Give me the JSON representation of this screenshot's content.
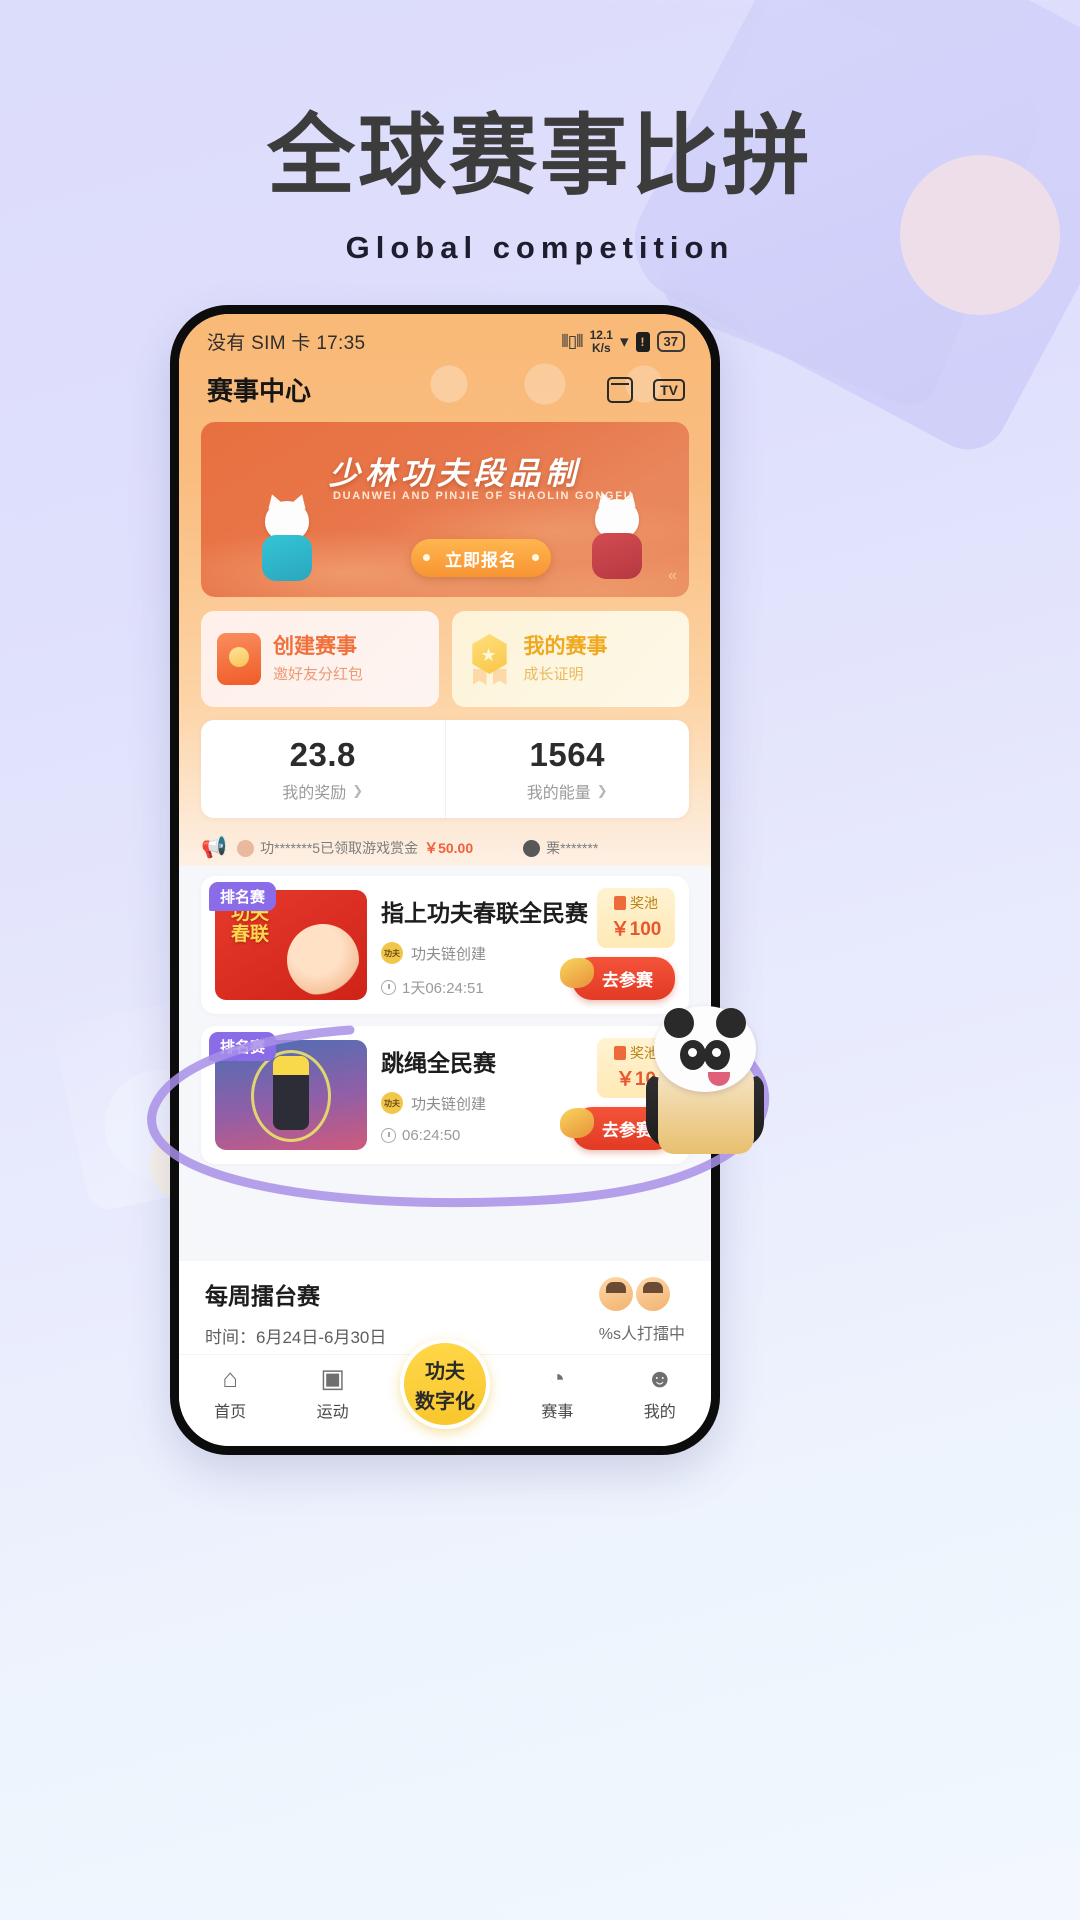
{
  "page": {
    "headline": "全球赛事比拼",
    "subheadline": "Global competition"
  },
  "statusbar": {
    "carrier_time": "没有 SIM 卡 17:35",
    "vibrate_icon": "vibrate-icon",
    "net_speed_value": "12.1",
    "net_speed_unit": "K/s",
    "wifi_icon": "wifi-icon",
    "battery_alert_icon": "!",
    "battery_level": "37"
  },
  "appheader": {
    "title": "赛事中心",
    "calendar_icon": "calendar-icon",
    "tv_icon": "TV"
  },
  "banner": {
    "title": "少林功夫段品制",
    "subtitle": "DUANWEI AND PINJIE OF SHAOLIN GONGFU",
    "cta": "立即报名",
    "arrows": "«"
  },
  "quick_cards": [
    {
      "title": "创建赛事",
      "subtitle": "邀好友分红包",
      "icon": "red-envelope-icon"
    },
    {
      "title": "我的赛事",
      "subtitle": "成长证明",
      "icon": "medal-icon"
    }
  ],
  "stats": [
    {
      "value": "23.8",
      "label": "我的奖励",
      "chevron": "❯"
    },
    {
      "value": "1564",
      "label": "我的能量",
      "chevron": "❯"
    }
  ],
  "notice": {
    "horn_icon": "📢",
    "items": [
      {
        "text": "功*******5已领取游戏赏金",
        "amount": "￥50.00"
      },
      {
        "text": "栗*******",
        "amount": ""
      }
    ]
  },
  "matches": [
    {
      "badge": "排名赛",
      "title": "指上功夫春联全民赛",
      "creator": "功夫链创建",
      "countdown": "1天06:24:51",
      "pool_label": "奖池",
      "pool_value": "￥100",
      "join": "去参赛",
      "thumb": "spring-festival-couplet-thumb"
    },
    {
      "badge": "排名赛",
      "title": "跳绳全民赛",
      "creator": "功夫链创建",
      "countdown": "06:24:50",
      "pool_label": "奖池",
      "pool_value": "￥10",
      "join": "去参赛",
      "thumb": "jump-rope-thumb"
    }
  ],
  "weekly": {
    "title": "每周擂台赛",
    "time": "时间：6月24日-6月30日",
    "participants": "%s人打擂中"
  },
  "tabbar": {
    "items": [
      {
        "label": "首页",
        "icon": "home-icon"
      },
      {
        "label": "运动",
        "icon": "play-square-icon"
      },
      {
        "label": "赛事",
        "icon": "trophy-clock-icon"
      },
      {
        "label": "我的",
        "icon": "user-icon"
      }
    ],
    "center": {
      "line1": "功夫",
      "line2": "数字化"
    }
  },
  "colors": {
    "accent_orange": "#f0703c",
    "accent_yellow": "#f0a91f",
    "badge_purple": "#8b6ce8",
    "join_red": "#e23a24",
    "bg_lavender": "#dcdcfb"
  }
}
